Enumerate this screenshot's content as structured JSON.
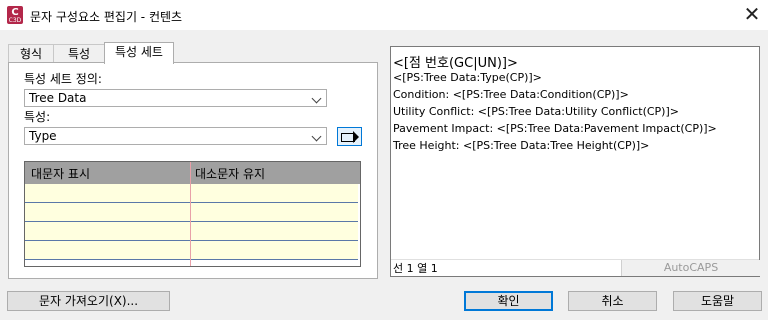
{
  "window": {
    "icon_label": "C",
    "icon_sub": "C3D",
    "title": "문자 구성요소 편집기 - 컨텐츠",
    "close_glyph": "✕"
  },
  "tabs": [
    {
      "label": "형식",
      "active": false
    },
    {
      "label": "특성",
      "active": false
    },
    {
      "label": "특성 세트",
      "active": true
    }
  ],
  "property_set": {
    "definition_label": "특성 세트 정의:",
    "definition_value": "Tree Data",
    "property_label": "특성:",
    "property_value": "Type"
  },
  "grid": {
    "headers": [
      "대문자 표시",
      "대소문자 유지"
    ]
  },
  "editor": {
    "lines": [
      "<[점 번호(GC|UN)]>",
      "<[PS:Tree Data:Type(CP)]>",
      "Condition: <[PS:Tree Data:Condition(CP)]>",
      "Utility Conflict: <[PS:Tree Data:Utility Conflict(CP)]>",
      "Pavement Impact: <[PS:Tree Data:Pavement Impact(CP)]>",
      "Tree Height: <[PS:Tree Data:Tree Height(CP)]>"
    ],
    "status_position": "선 1 열 1",
    "status_caps": "AutoCAPS"
  },
  "buttons": {
    "import_text": "문자 가져오기(X)...",
    "ok": "확인",
    "cancel": "취소",
    "help": "도움말"
  }
}
